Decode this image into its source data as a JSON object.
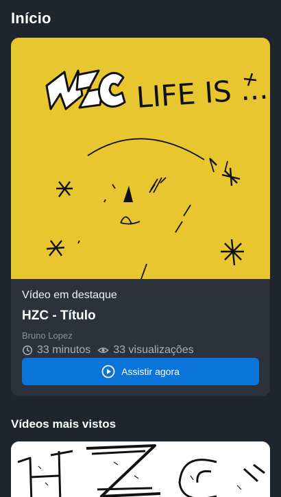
{
  "header": {
    "title": "Início"
  },
  "featured": {
    "section_label": "Vídeo em destaque",
    "title": "HZC - Título",
    "author": "Bruno Lopez",
    "duration": "33 minutos",
    "views": "33 visualizações",
    "watch_label": "Assistir agora",
    "thumbnail_text": "LIFE IS ...",
    "thumbnail_bg": "#e7c62f",
    "button_color": "#0b74d8"
  },
  "most_viewed": {
    "heading": "Vídeos mais vistos"
  },
  "icons": {
    "clock": "clock-icon",
    "eye": "eye-icon",
    "play": "play-circle-icon"
  }
}
